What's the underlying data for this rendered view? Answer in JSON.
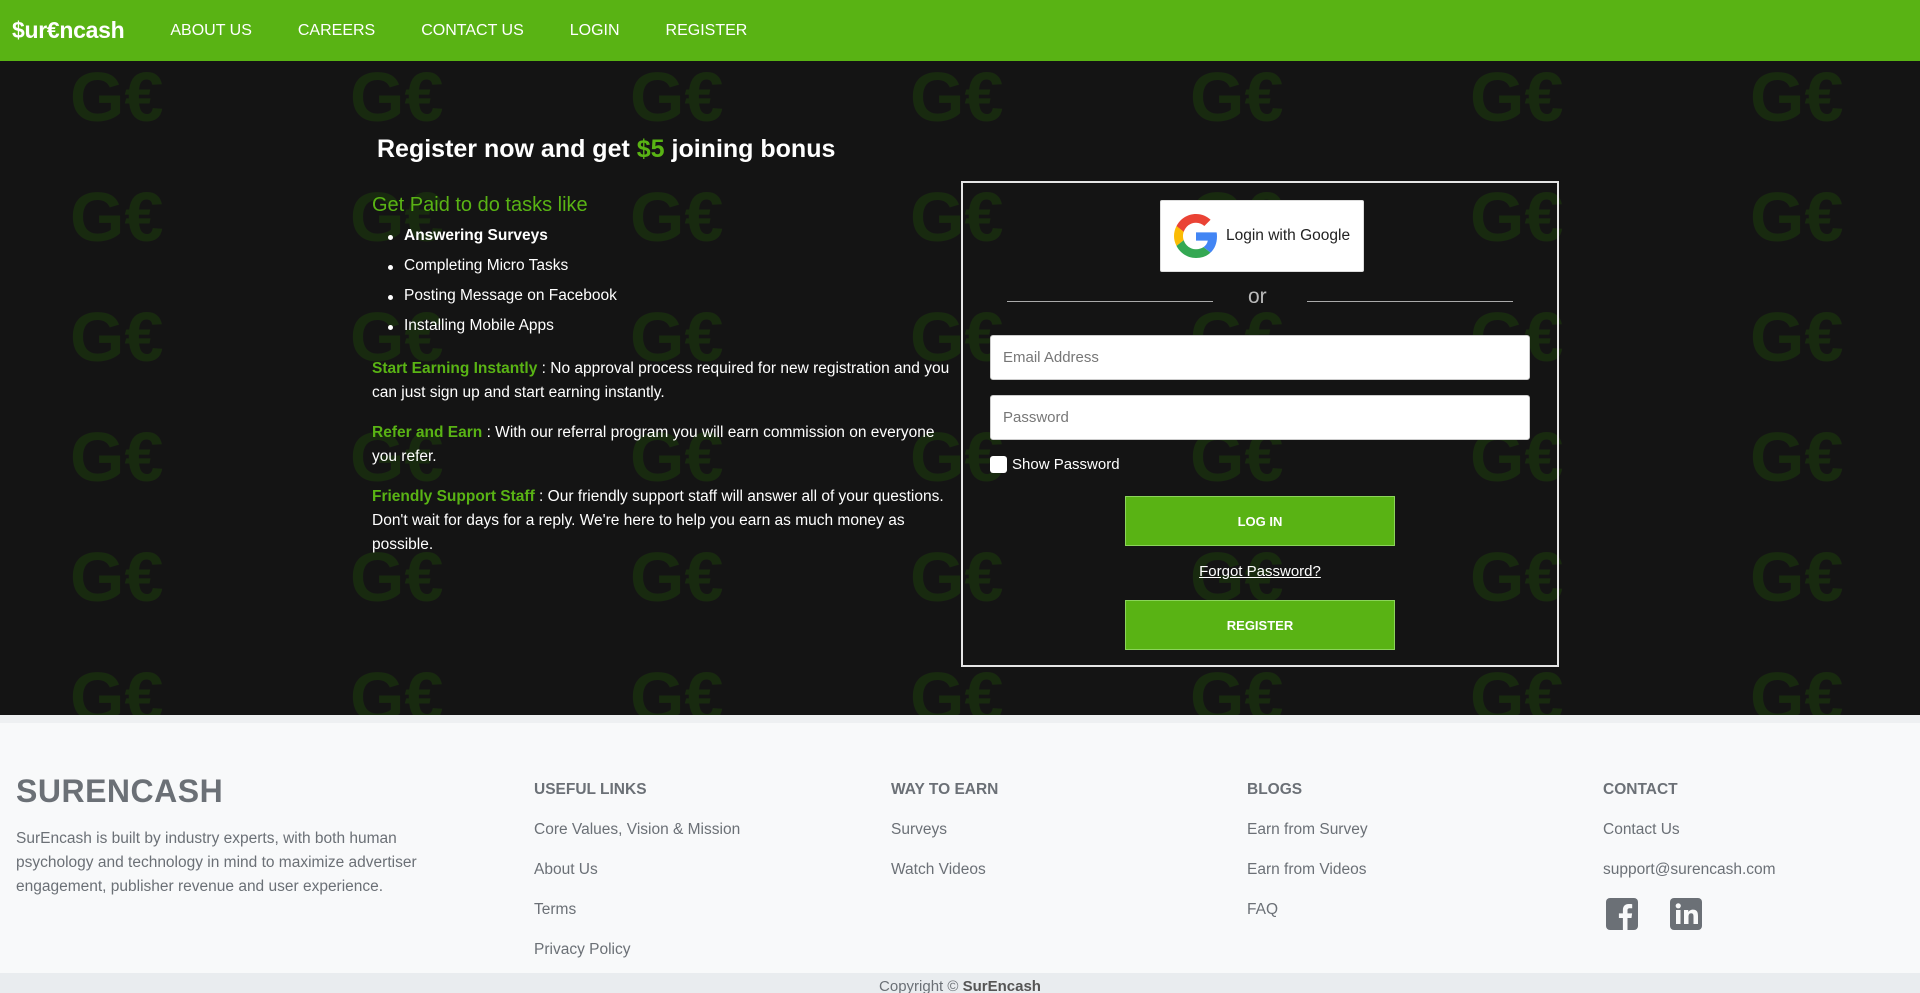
{
  "nav": {
    "brand": "$ur€ncash",
    "links": [
      "ABOUT US",
      "CAREERS",
      "CONTACT US",
      "LOGIN",
      "REGISTER"
    ]
  },
  "hero": {
    "title_prefix": "Register now and get ",
    "title_amount": "$5",
    "title_suffix": " joining bonus",
    "tasks_heading": "Get Paid to do tasks like",
    "tasks": [
      "Answering Surveys",
      "Completing Micro Tasks",
      "Posting Message on Facebook",
      "Installing Mobile Apps"
    ],
    "features": [
      {
        "title": "Start Earning Instantly",
        "text": " : No approval process required for new registration and you can just sign up and start earning instantly."
      },
      {
        "title": "Refer and Earn",
        "text": " : With our referral program you will earn commission on everyone you refer."
      },
      {
        "title": "Friendly Support Staff",
        "text": " : Our friendly support staff will answer all of your questions. Don't wait for days for a reply. We're here to help you earn as much money as possible."
      }
    ]
  },
  "login": {
    "google_label": "Login with Google",
    "or_text": "or",
    "email_placeholder": "Email Address",
    "password_placeholder": "Password",
    "show_password": "Show Password",
    "login_button": "LOG IN",
    "forgot": "Forgot Password?",
    "register_button": "REGISTER"
  },
  "footer": {
    "brand": "SURENCASH",
    "description": "SurEncash is built by industry experts, with both human psychology and technology in mind to maximize advertiser engagement, publisher revenue and user experience.",
    "columns": [
      {
        "title": "USEFUL LINKS",
        "links": [
          "Core Values, Vision & Mission",
          "About Us",
          "Terms",
          "Privacy Policy"
        ]
      },
      {
        "title": "WAY TO EARN",
        "links": [
          "Surveys",
          "Watch Videos"
        ]
      },
      {
        "title": "BLOGS",
        "links": [
          "Earn from Survey",
          "Earn from Videos",
          "FAQ"
        ]
      },
      {
        "title": "CONTACT",
        "links": [
          "Contact Us",
          "support@surencash.com"
        ]
      }
    ],
    "social": [
      "facebook-icon",
      "linkedin-icon"
    ],
    "copyright_prefix": "Copyright © ",
    "copyright_brand": "SurEncash"
  },
  "colors": {
    "accent": "#59b314",
    "hero_bg": "#151515",
    "footer_text": "#6b7076"
  }
}
